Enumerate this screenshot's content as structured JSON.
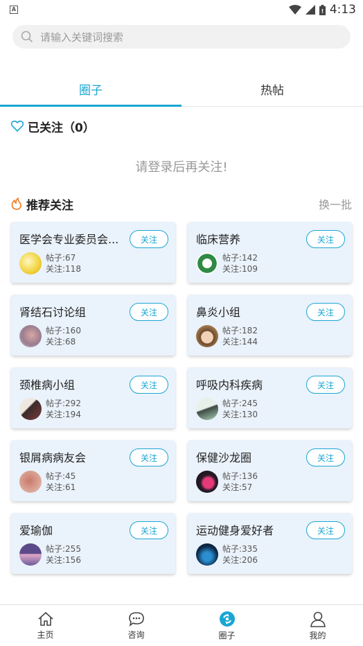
{
  "status_bar": {
    "time": "4:13"
  },
  "search": {
    "placeholder": "请输入关键词搜索"
  },
  "tabs": [
    {
      "label": "圈子"
    },
    {
      "label": "热帖"
    }
  ],
  "followed": {
    "label": "已关注（0）"
  },
  "login_tip": "请登录后再关注!",
  "recommend": {
    "title": "推荐关注",
    "swap": "换一批"
  },
  "follow_label": "关注",
  "groups": [
    {
      "name": "医学会专业委员会...",
      "posts": "帖子:67",
      "fans": "关注:118"
    },
    {
      "name": "临床营养",
      "posts": "帖子:142",
      "fans": "关注:109"
    },
    {
      "name": "肾结石讨论组",
      "posts": "帖子:160",
      "fans": "关注:68"
    },
    {
      "name": "鼻炎小组",
      "posts": "帖子:182",
      "fans": "关注:144"
    },
    {
      "name": "颈椎病小组",
      "posts": "帖子:292",
      "fans": "关注:194"
    },
    {
      "name": "呼吸内科疾病",
      "posts": "帖子:245",
      "fans": "关注:130"
    },
    {
      "name": "银屑病病友会",
      "posts": "帖子:45",
      "fans": "关注:61"
    },
    {
      "name": "保健沙龙圈",
      "posts": "帖子:136",
      "fans": "关注:57"
    },
    {
      "name": "爱瑜伽",
      "posts": "帖子:255",
      "fans": "关注:156"
    },
    {
      "name": "运动健身爱好者",
      "posts": "帖子:335",
      "fans": "关注:206"
    }
  ],
  "nav": [
    {
      "label": "主页",
      "icon": "home-icon"
    },
    {
      "label": "咨询",
      "icon": "chat-icon"
    },
    {
      "label": "圈子",
      "icon": "circle-icon"
    },
    {
      "label": "我的",
      "icon": "user-icon"
    }
  ],
  "colors": {
    "accent": "#1aa6d3",
    "card_bg": "#eaf2fb"
  }
}
